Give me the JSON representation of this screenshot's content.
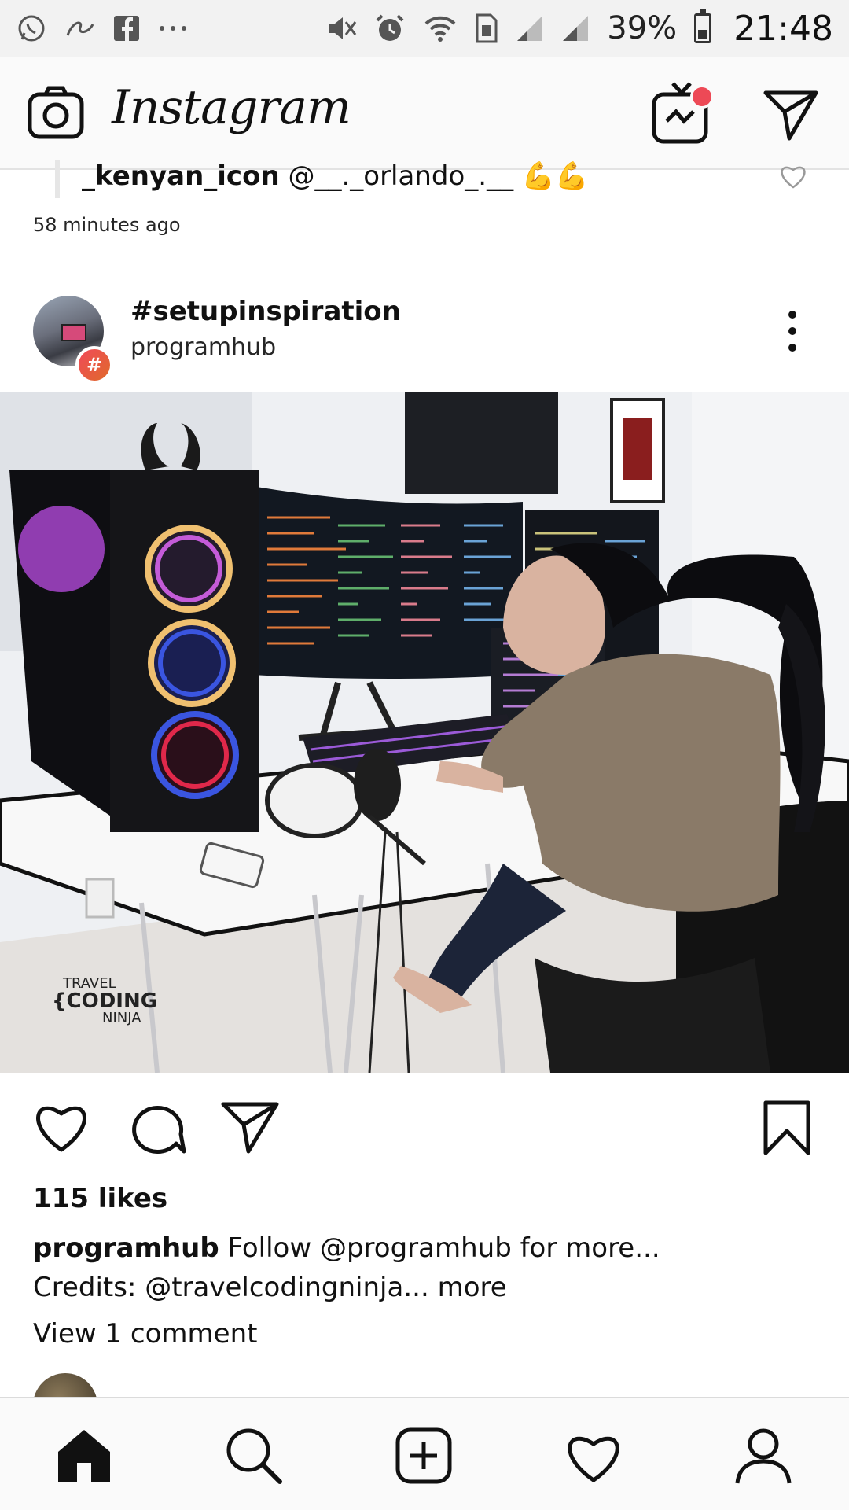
{
  "status_bar": {
    "battery": "39%",
    "battery_level": 0.39,
    "time": "21:48",
    "left_icons": [
      "whatsapp-icon",
      "link-icon",
      "facebook-icon",
      "more-dots-icon"
    ],
    "right_icons": [
      "mute-icon",
      "alarm-icon",
      "wifi-icon",
      "sim-icon",
      "signal-icon",
      "signal-icon",
      "battery-icon"
    ]
  },
  "header": {
    "logo": "Instagram",
    "icons": [
      "camera-icon",
      "igtv-icon",
      "direct-message-icon"
    ],
    "igtv_badge_color": "#ed4956"
  },
  "previous_post": {
    "caption_user": "_kenyan_icon",
    "caption_text": "@__._orlando_.__ 💪💪",
    "time_ago": "58 minutes ago"
  },
  "post": {
    "hashtag": "#setupinspiration",
    "account": "programhub",
    "badge": "#",
    "image_watermark": {
      "line1": "TRAVEL",
      "line2": "{CODING",
      "line3": "NINJA"
    },
    "likes": "115 likes",
    "caption_user": "programhub",
    "caption_line1": "Follow @programhub for more...",
    "caption_line2": "Credits: @travelcodingninja...",
    "caption_more": "more",
    "view_comments": "View 1 comment"
  },
  "bottom_nav": {
    "items": [
      "home-icon",
      "search-icon",
      "new-post-icon",
      "activity-icon",
      "profile-icon"
    ]
  }
}
